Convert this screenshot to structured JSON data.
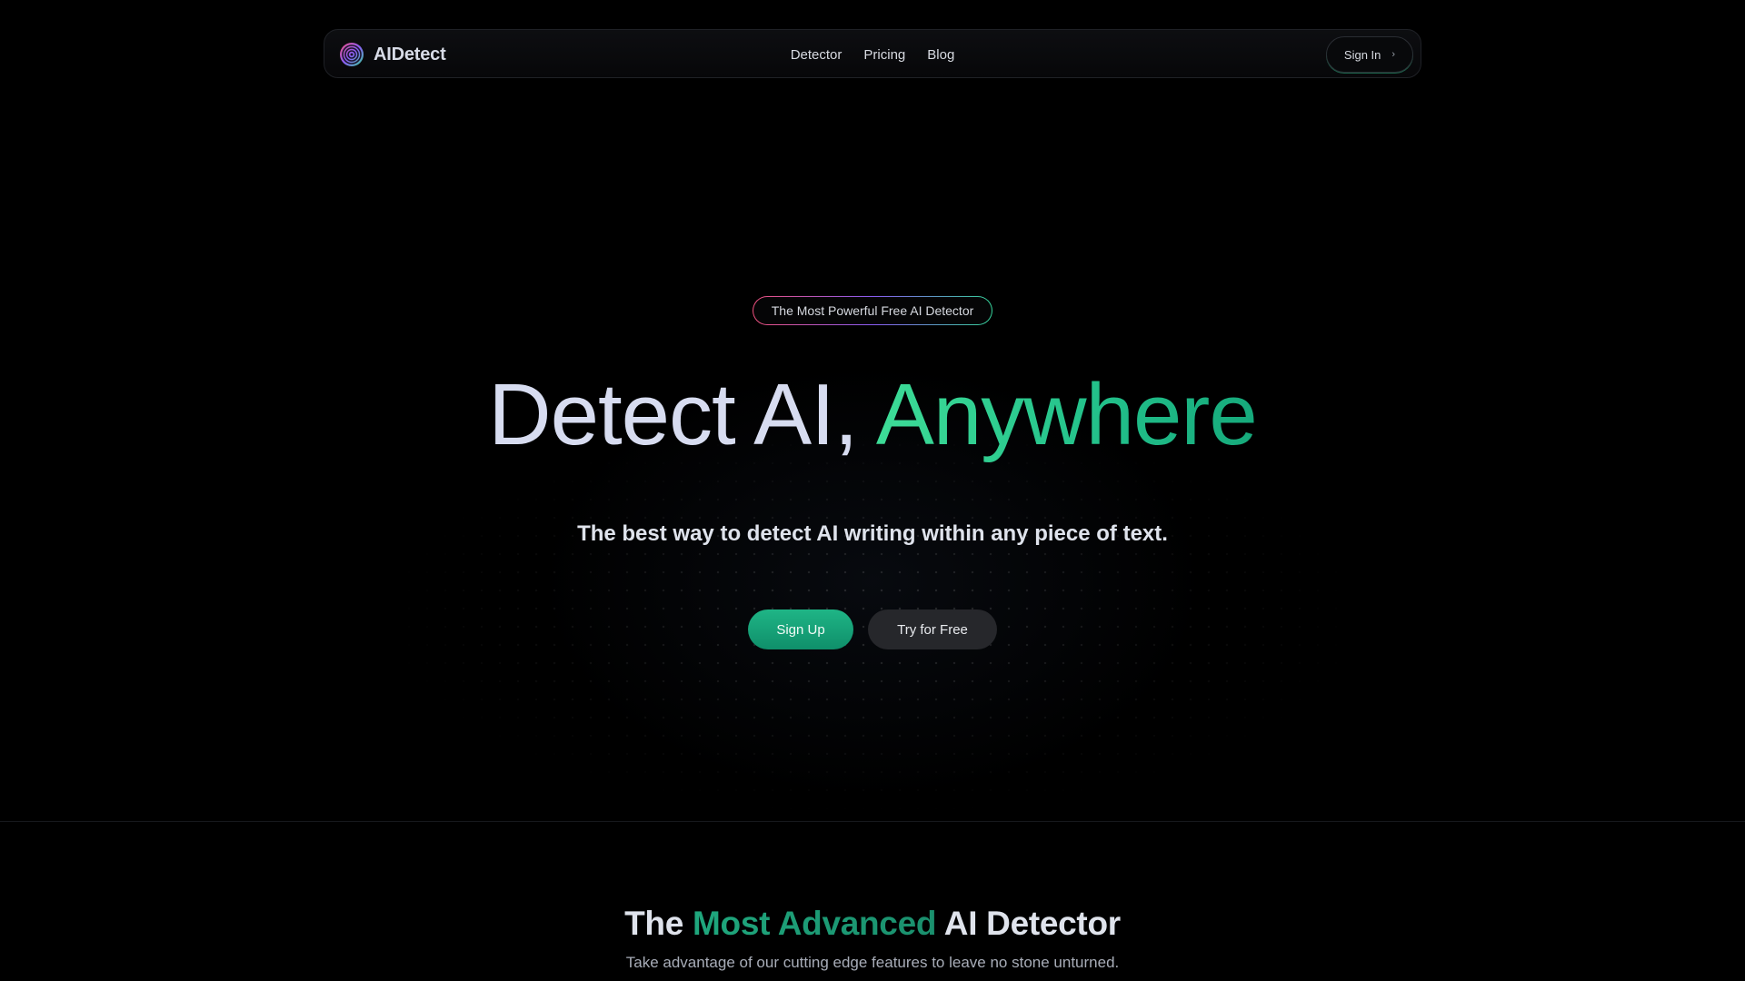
{
  "navbar": {
    "brand": "AIDetect",
    "links": [
      {
        "label": "Detector"
      },
      {
        "label": "Pricing"
      },
      {
        "label": "Blog"
      }
    ],
    "signin_label": "Sign In",
    "signin_chevron": "›"
  },
  "hero": {
    "badge": "The Most Powerful Free AI Detector",
    "title_part1": "Detect AI, ",
    "title_part2": "Anywhere",
    "subtitle": "The best way to detect AI writing within any piece of text.",
    "primary_cta": "Sign Up",
    "secondary_cta": "Try for Free"
  },
  "features": {
    "title_part1": "The ",
    "title_part2": "Most Advanced",
    "title_part3": " AI Detector",
    "subtitle": "Take advantage of our cutting edge features to leave no stone unturned."
  },
  "colors": {
    "background": "#000000",
    "accent_green": "#22c08a",
    "button_primary": "#15a378",
    "button_secondary": "#26272b",
    "badge_gradient": [
      "#f0507d",
      "#8b5cf6",
      "#34d399"
    ]
  },
  "icons": {
    "logo": "concentric-target-logo-icon",
    "signin": "chevron-right-icon"
  }
}
